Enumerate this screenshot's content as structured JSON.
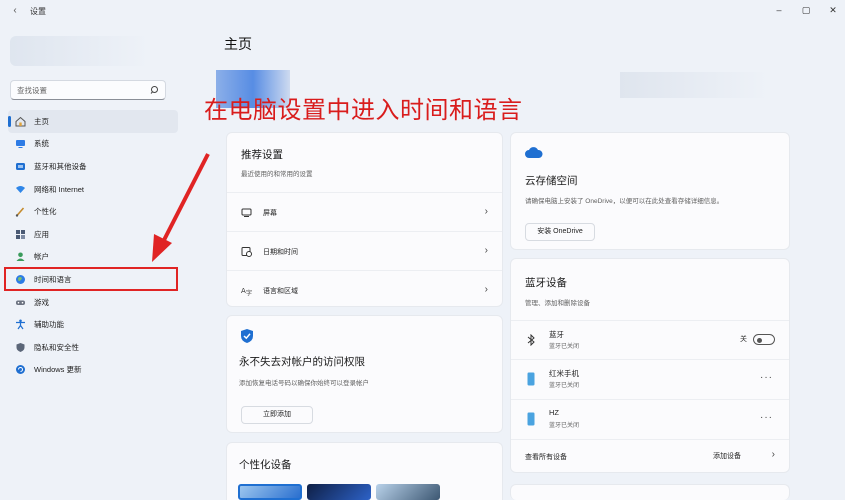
{
  "window": {
    "back_glyph": "‹",
    "title": "设置",
    "controls": {
      "minimize": "–",
      "maximize": "▢",
      "close": "✕"
    }
  },
  "search": {
    "placeholder": "查找设置"
  },
  "sidebar": {
    "items": [
      {
        "label": "主页",
        "icon": "home-icon",
        "active": true
      },
      {
        "label": "系统",
        "icon": "system-icon"
      },
      {
        "label": "蓝牙和其他设备",
        "icon": "bluetooth-devices-icon"
      },
      {
        "label": "网络和 Internet",
        "icon": "network-icon"
      },
      {
        "label": "个性化",
        "icon": "personalization-icon"
      },
      {
        "label": "应用",
        "icon": "apps-icon"
      },
      {
        "label": "帐户",
        "icon": "account-icon"
      },
      {
        "label": "时间和语言",
        "icon": "time-language-icon"
      },
      {
        "label": "游戏",
        "icon": "gaming-icon"
      },
      {
        "label": "辅助功能",
        "icon": "accessibility-icon"
      },
      {
        "label": "隐私和安全性",
        "icon": "privacy-icon"
      },
      {
        "label": "Windows 更新",
        "icon": "windows-update-icon"
      }
    ]
  },
  "main": {
    "title": "主页"
  },
  "annotation": {
    "text": "在电脑设置中进入时间和语言",
    "color": "#d91c1c"
  },
  "recommended": {
    "title": "推荐设置",
    "subtitle": "最近使用的和常用的设置",
    "rows": [
      {
        "label": "屏幕",
        "icon": "display-icon"
      },
      {
        "label": "日期和时间",
        "icon": "date-time-icon"
      },
      {
        "label": "语言和区域",
        "icon": "language-region-icon"
      }
    ],
    "chevron": "›"
  },
  "cloud": {
    "title": "云存储空间",
    "description": "请确保电脑上安装了 OneDrive，以便可以在此处查看存储详细信息。",
    "button": "安装 OneDrive"
  },
  "account_access": {
    "title": "永不失去对帐户的访问权限",
    "description": "添加恢复电话号码以确保你始终可以登录帐户",
    "button": "立即添加"
  },
  "bluetooth": {
    "title": "蓝牙设备",
    "subtitle": "管理、添加和删除设备",
    "toggle_row": {
      "name": "蓝牙",
      "status": "蓝牙已关闭",
      "toggle_label": "关"
    },
    "devices": [
      {
        "name": "红米手机",
        "status": "蓝牙已关闭"
      },
      {
        "name": "HZ",
        "status": "蓝牙已关闭"
      }
    ],
    "more": "···",
    "footer_label": "查看所有设备",
    "footer_button": "添加设备",
    "chevron": "›"
  },
  "personalization": {
    "title": "个性化设备"
  },
  "colors": {
    "accent": "#1f6fd1",
    "highlight_box": "#e02424"
  }
}
